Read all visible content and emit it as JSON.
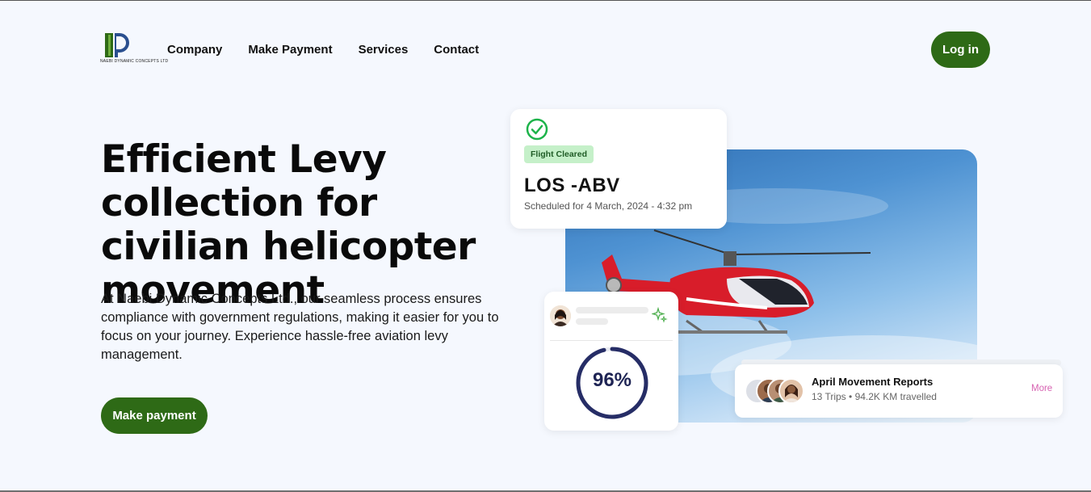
{
  "brand": {
    "logo_text": "NAEBI DYNAMIC CONCEPTS LTD",
    "accent_color": "#2e6a16"
  },
  "nav": {
    "items": [
      "Company",
      "Make Payment",
      "Services",
      "Contact"
    ],
    "login_label": "Log in"
  },
  "hero": {
    "headline": "Efficient Levy collection for civilian helicopter movement",
    "lead": "At Naebi Dynamic Concepts Ltd., our seamless process ensures compliance with government regulations, making it easier for you to focus on your journey. Experience hassle-free aviation levy management.",
    "cta_label": "Make payment"
  },
  "flight_card": {
    "status": "Flight Cleared",
    "route": "LOS -ABV",
    "schedule": "Scheduled for 4 March, 2024 - 4:32 pm",
    "icon": "check-circle-icon"
  },
  "stats_card": {
    "percent": 96,
    "percent_label": "96%",
    "icon": "sparkle-icon"
  },
  "report_card": {
    "title": "April Movement Reports",
    "trips": "13 Trips",
    "distance": "94.2K KM travelled",
    "more_label": "More"
  }
}
